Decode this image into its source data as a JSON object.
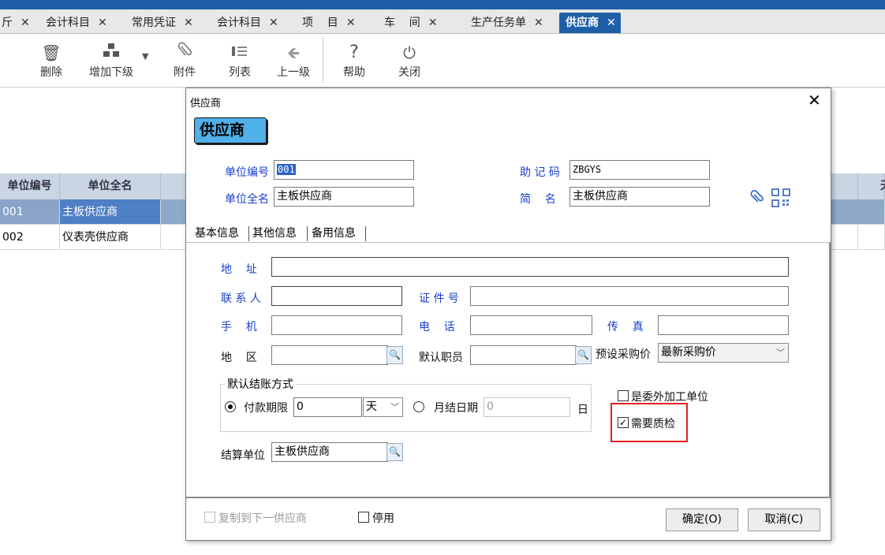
{
  "tabs": [
    {
      "label": "斤"
    },
    {
      "label": "会计科目"
    },
    {
      "label": "常用凭证"
    },
    {
      "label": "会计科目"
    },
    {
      "label": "项    目"
    },
    {
      "label": "车    间"
    },
    {
      "label": "生产任务单"
    },
    {
      "label": "供应商"
    }
  ],
  "close_glyph": "✕",
  "toolbar": {
    "delete": "删除",
    "add_sub": "增加下级",
    "attach": "附件",
    "list": "列表",
    "up": "上一级",
    "help": "帮助",
    "close": "关闭"
  },
  "grid": {
    "headers": [
      "单位编号",
      "单位全名"
    ],
    "rows": [
      {
        "code": "001",
        "name": "主板供应商"
      },
      {
        "code": "002",
        "name": "仪表壳供应商"
      }
    ],
    "right_header_fragment": "天"
  },
  "dialog": {
    "title": "供应商",
    "badge": "供应商",
    "code_label": "单位编号",
    "code_value": "001",
    "mnemonic_label": "助 记 码",
    "mnemonic_value": "ZBGYS",
    "fullname_label": "单位全名",
    "fullname_value": "主板供应商",
    "short_label": "简    名",
    "short_value": "主板供应商",
    "tabs": [
      "基本信息",
      "其他信息",
      "备用信息"
    ],
    "address_label": "地    址",
    "address_value": "",
    "contact_label": "联 系 人",
    "contact_value": "",
    "idno_label": "证 件 号",
    "idno_value": "",
    "mobile_label": "手    机",
    "mobile_value": "",
    "phone_label": "电    话",
    "phone_value": "",
    "fax_label": "传    真",
    "fax_value": "",
    "region_label": "地    区",
    "region_value": "",
    "staff_label": "默认职员",
    "staff_value": "",
    "price_label": "预设采购价",
    "price_value": "最新采购价",
    "settle_group": "默认结账方式",
    "term_label": "付款期限",
    "term_value": "0",
    "term_unit": "天",
    "monthly_label": "月结日期",
    "monthly_value": "0",
    "monthly_unit": "日",
    "outsource_label": "是委外加工单位",
    "qc_label": "需要质检",
    "settle_unit_label": "结算单位",
    "settle_unit_value": "主板供应商",
    "copy_label": "复制到下一供应商",
    "disable_label": "停用",
    "ok_label": "确定(O)",
    "cancel_label": "取消(C)"
  }
}
